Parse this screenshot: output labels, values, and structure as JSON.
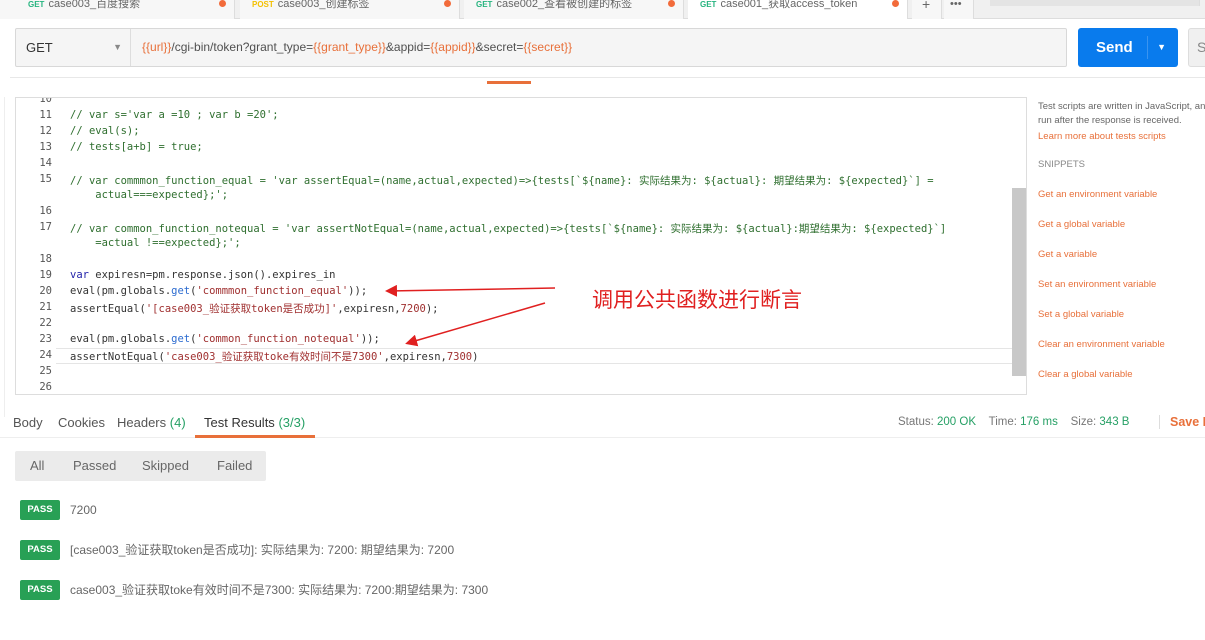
{
  "tabs": [
    {
      "method": "GET",
      "name": "case003_百度搜索"
    },
    {
      "method": "POST",
      "name": "case003_创建标签"
    },
    {
      "method": "GET",
      "name": "case002_查看被创建的标签"
    },
    {
      "method": "GET",
      "name": "case001_获取access_token"
    }
  ],
  "tab_actions": {
    "add": "+",
    "more": "•••"
  },
  "request": {
    "method": "GET",
    "url_parts": [
      {
        "t": "{{url}}",
        "v": true
      },
      {
        "t": "/cgi-bin/token?grant_type=",
        "v": false
      },
      {
        "t": "{{grant_type}}",
        "v": true
      },
      {
        "t": "&appid=",
        "v": false
      },
      {
        "t": "{{appid}}",
        "v": true
      },
      {
        "t": "&secret=",
        "v": false
      },
      {
        "t": "{{secret}}",
        "v": true
      }
    ],
    "send": "Send",
    "save": "S"
  },
  "editor": {
    "lines": [
      {
        "n": "10",
        "s": []
      },
      {
        "n": "11",
        "s": [
          {
            "t": "// var s='var a =10 ; var b =20';",
            "c": "cm"
          }
        ]
      },
      {
        "n": "12",
        "s": [
          {
            "t": "// eval(s);",
            "c": "cm"
          }
        ]
      },
      {
        "n": "13",
        "s": [
          {
            "t": "// tests[a+b] = true;",
            "c": "cm"
          }
        ]
      },
      {
        "n": "14",
        "s": []
      },
      {
        "n": "15",
        "s": [
          {
            "t": "// var commmon_function_equal = 'var assertEqual=(name,actual,expected)=>{tests[`${name}: 实际结果为: ${actual}: 期望结果为: ${expected}`] =",
            "c": "cm"
          }
        ]
      },
      {
        "n": "",
        "s": [
          {
            "t": "    actual===expected};';",
            "c": "cm"
          }
        ]
      },
      {
        "n": "16",
        "s": []
      },
      {
        "n": "17",
        "s": [
          {
            "t": "// var common_function_notequal = 'var assertNotEqual=(name,actual,expected)=>{tests[`${name}: 实际结果为: ${actual}:期望结果为: ${expected}`]",
            "c": "cm"
          }
        ]
      },
      {
        "n": "",
        "s": [
          {
            "t": "    =actual !==expected};';",
            "c": "cm"
          }
        ]
      },
      {
        "n": "18",
        "s": []
      },
      {
        "n": "19",
        "s": [
          {
            "t": "var",
            "c": "kw"
          },
          {
            "t": " expiresn=pm.response.json().expires_in",
            "c": ""
          }
        ]
      },
      {
        "n": "20",
        "s": [
          {
            "t": "eval(pm.globals.",
            "c": ""
          },
          {
            "t": "get",
            "c": "fn"
          },
          {
            "t": "(",
            "c": ""
          },
          {
            "t": "'commmon_function_equal'",
            "c": "st"
          },
          {
            "t": "));",
            "c": ""
          }
        ]
      },
      {
        "n": "21",
        "s": [
          {
            "t": "assertEqual(",
            "c": ""
          },
          {
            "t": "'[case003_验证获取token是否成功]'",
            "c": "st"
          },
          {
            "t": ",expiresn,",
            "c": ""
          },
          {
            "t": "7200",
            "c": "st"
          },
          {
            "t": ");",
            "c": ""
          }
        ]
      },
      {
        "n": "22",
        "s": []
      },
      {
        "n": "23",
        "s": [
          {
            "t": "eval(pm.globals.",
            "c": ""
          },
          {
            "t": "get",
            "c": "fn"
          },
          {
            "t": "(",
            "c": ""
          },
          {
            "t": "'common_function_notequal'",
            "c": "st"
          },
          {
            "t": "));",
            "c": ""
          }
        ]
      },
      {
        "n": "24",
        "s": [
          {
            "t": "assertNotEqual(",
            "c": ""
          },
          {
            "t": "'case003_验证获取toke有效时间不是7300'",
            "c": "st"
          },
          {
            "t": ",expiresn,",
            "c": ""
          },
          {
            "t": "7300",
            "c": "st"
          },
          {
            "t": ")",
            "c": ""
          }
        ]
      },
      {
        "n": "25",
        "s": []
      },
      {
        "n": "26",
        "s": []
      }
    ]
  },
  "annotation": "调用公共函数进行断言",
  "sidebar": {
    "intro_1": "Test scripts are written in JavaScript, and are",
    "intro_2": "run after the response is received.",
    "learn_more": "Learn more about tests scripts",
    "snippets_title": "SNIPPETS",
    "snippets": [
      "Get an environment variable",
      "Get a global variable",
      "Get a variable",
      "Set an environment variable",
      "Set a global variable",
      "Clear an environment variable",
      "Clear a global variable"
    ]
  },
  "response": {
    "tabs": [
      {
        "label": "Body",
        "count": ""
      },
      {
        "label": "Cookies",
        "count": ""
      },
      {
        "label": "Headers",
        "count": "(4)"
      },
      {
        "label": "Test Results",
        "count": "(3/3)"
      }
    ],
    "status_label": "Status:",
    "status": "200 OK",
    "time_label": "Time:",
    "time": "176 ms",
    "size_label": "Size:",
    "size": "343 B",
    "save": "Save Response",
    "filters": [
      "All",
      "Passed",
      "Skipped",
      "Failed"
    ],
    "results": [
      {
        "badge": "PASS",
        "text": "7200"
      },
      {
        "badge": "PASS",
        "text": "[case003_验证获取token是否成功]: 实际结果为: 7200: 期望结果为: 7200"
      },
      {
        "badge": "PASS",
        "text": "case003_验证获取toke有效时间不是7300: 实际结果为:  7200:期望结果为: 7300"
      }
    ]
  },
  "colors": {
    "accent": "#e8703a",
    "send": "#097bed",
    "pass": "#28a055",
    "annotation": "#e02020"
  }
}
